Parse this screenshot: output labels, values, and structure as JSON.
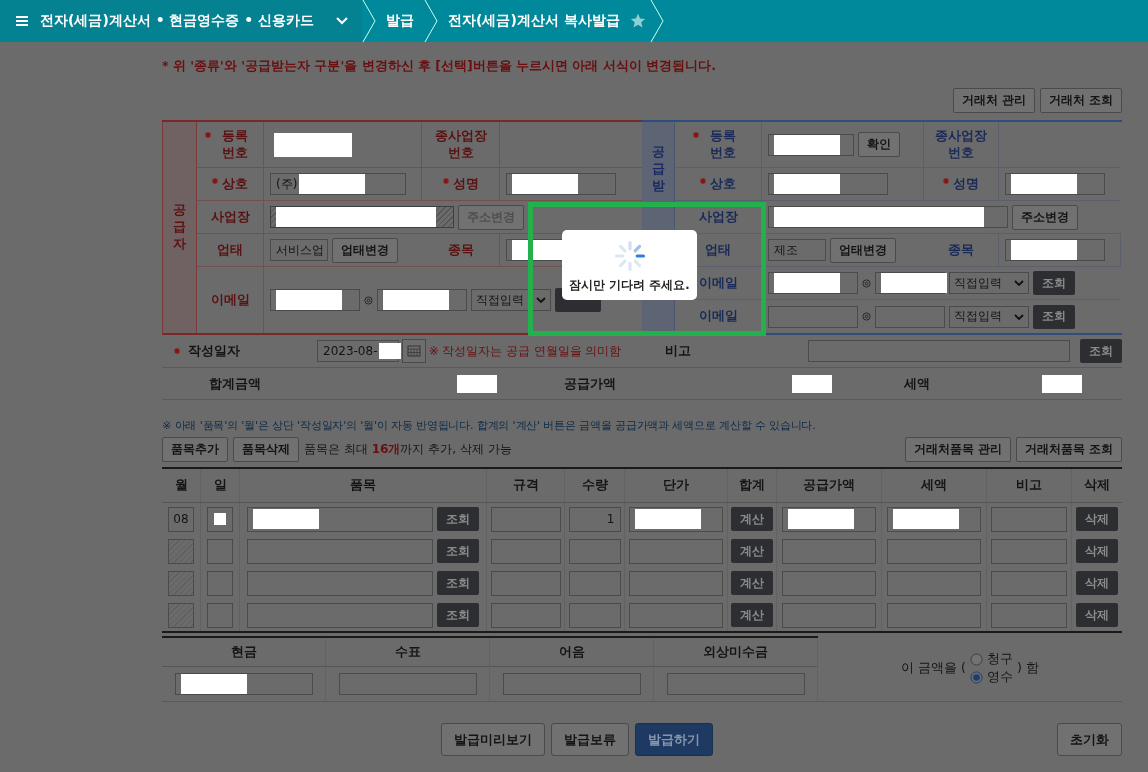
{
  "header": {
    "title": "전자(세금)계산서 • 현금영수증 • 신용카드",
    "crumbs": [
      "발급",
      "전자(세금)계산서 복사발급"
    ],
    "favorite": false
  },
  "notice": "* 위 '종류'와 '공급받는자 구분'을 변경하신 후 [선택]버튼을 누르시면 아래 서식이 변경됩니다.",
  "partner_buttons": [
    "거래처 관리",
    "거래처 조회"
  ],
  "supplier": {
    "side_label": "공급자",
    "reg": {
      "label": "등록 번호",
      "required": true,
      "redacted": true
    },
    "branch": {
      "label": "종사업장 번호"
    },
    "name": {
      "label": "상호",
      "required": true,
      "value": "(주)",
      "redacted": true
    },
    "rep": {
      "label": "성명",
      "required": true,
      "redacted": true
    },
    "address": {
      "label": "사업장",
      "disabled": true,
      "redacted": true,
      "button": "주소변경",
      "button_disabled": true
    },
    "business": {
      "label": "업태",
      "value": "서비스업",
      "button": "업태변경"
    },
    "item": {
      "label": "종목",
      "redacted": true
    },
    "email": {
      "label": "이메일",
      "local_redacted": true,
      "domain_redacted": true,
      "select": "직접입력"
    }
  },
  "buyer": {
    "side_label": "공급받",
    "reg": {
      "label": "등록 번호",
      "required": true,
      "redacted": true,
      "button": "확인"
    },
    "branch": {
      "label": "종사업장 번호"
    },
    "name": {
      "label": "상호",
      "required": true,
      "redacted": true
    },
    "rep": {
      "label": "성명",
      "required": true,
      "redacted": true
    },
    "address": {
      "label": "사업장",
      "redacted": true,
      "button": "주소변경"
    },
    "business": {
      "label": "업태",
      "value": "제조",
      "button": "업태변경"
    },
    "item": {
      "label": "종목",
      "redacted": true
    },
    "emails": [
      {
        "label": "이메일",
        "local_redacted": true,
        "domain_redacted": true,
        "select": "직접입력",
        "button": "조회"
      },
      {
        "label": "이메일",
        "select": "직접입력",
        "button": "조회"
      }
    ]
  },
  "date": {
    "label": "작성일자",
    "required": true,
    "value": "2023-08-",
    "redacted": true,
    "note": "※ 작성일자는 공급 연월일을 의미함"
  },
  "remark": {
    "label": "비고",
    "button": "조회"
  },
  "totals": [
    {
      "label": "합계금액",
      "redacted": true
    },
    {
      "label": "공급가액",
      "redacted": true
    },
    {
      "label": "세액",
      "redacted": true
    }
  ],
  "items_note": "※ 아래 '품목'의 '월'은 상단 '작성일자'의 '월'이 자동 반영됩니다. 합계의 '계산' 버튼은 금액을 공급가액과 세액으로 계산할 수 있습니다.",
  "item_buttons": [
    "품목추가",
    "품목삭제"
  ],
  "item_limit": "품목은 최대 **16개**까지 추가, 삭제 가능",
  "partner_item_buttons": [
    "거래처품목 관리",
    "거래처품목 조회"
  ],
  "items": {
    "columns": [
      "월",
      "일",
      "품목",
      "규격",
      "수량",
      "단가",
      "합계",
      "공급가액",
      "세액",
      "비고",
      "삭제"
    ],
    "rows": [
      {
        "month": "08",
        "day_redacted": true,
        "name_redacted": true,
        "lookup": "조회",
        "qty": "1",
        "price_redacted": true,
        "calc": "계산",
        "supply_redacted": true,
        "tax_redacted": true,
        "delete": "삭제"
      },
      {
        "month_disabled": true,
        "lookup": "조회",
        "calc": "계산",
        "delete": "삭제"
      },
      {
        "month_disabled": true,
        "lookup": "조회",
        "calc": "계산",
        "delete": "삭제"
      },
      {
        "month_disabled": true,
        "lookup": "조회",
        "calc": "계산",
        "delete": "삭제"
      }
    ]
  },
  "payment": {
    "columns": [
      {
        "label": "현금",
        "redacted": true
      },
      {
        "label": "수표"
      },
      {
        "label": "어음"
      },
      {
        "label": "외상미수금"
      }
    ],
    "prefix": "이 금액을 (",
    "options": [
      {
        "label": "청구",
        "selected": false
      },
      {
        "label": "영수",
        "selected": true
      }
    ],
    "suffix": ") 함"
  },
  "actions": [
    {
      "label": "발급미리보기",
      "kind": "default"
    },
    {
      "label": "발급보류",
      "kind": "default"
    },
    {
      "label": "발급하기",
      "kind": "primary"
    }
  ],
  "reset": "초기화",
  "dialog": {
    "message": "잠시만 기다려 주세요."
  }
}
